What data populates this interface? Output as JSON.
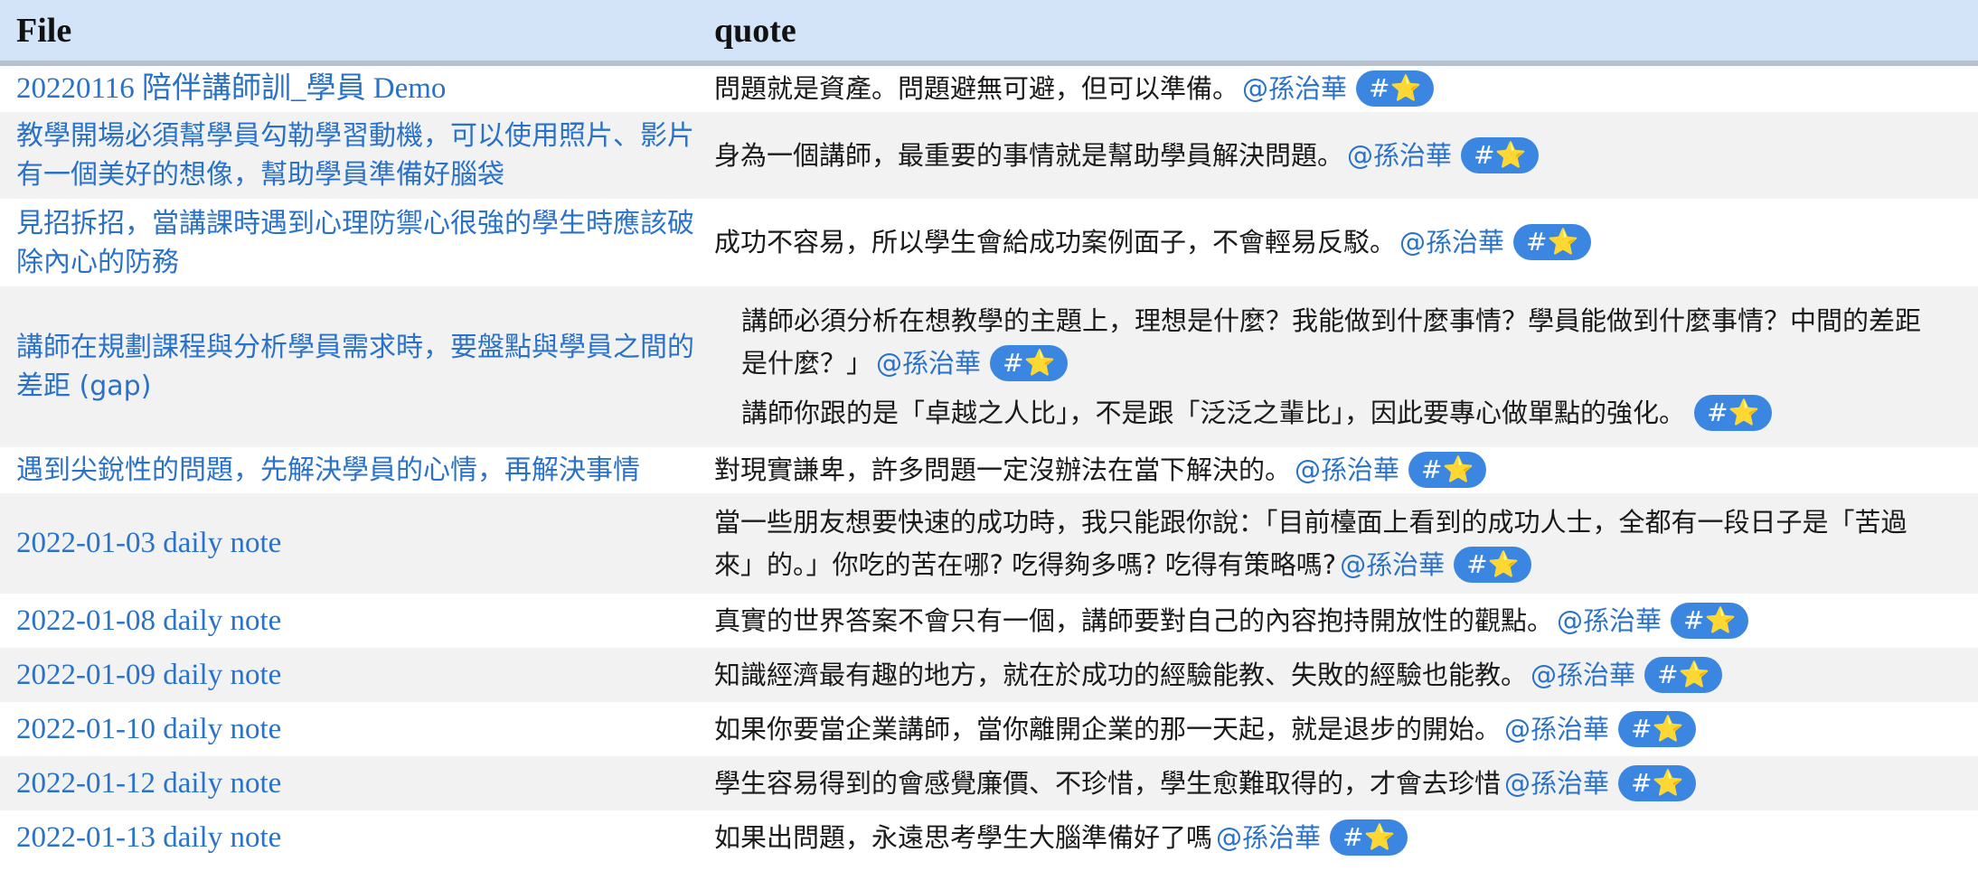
{
  "table": {
    "headers": {
      "file": "File",
      "quote": "quote"
    },
    "tag_label": "#",
    "tag_icon": "star-icon",
    "accent_color": "#2a72c8",
    "rows": [
      {
        "file": "20220116 陪伴講師訓_學員 Demo",
        "quotes": [
          {
            "text": "問題就是資產。問題避無可避，但可以準備。",
            "mention": "@孫治華",
            "tag": "#⭐"
          }
        ]
      },
      {
        "file": "教學開場必須幫學員勾勒學習動機，可以使用照片、影片有一個美好的想像，幫助學員準備好腦袋",
        "quotes": [
          {
            "text": "身為一個講師，最重要的事情就是幫助學員解決問題。",
            "mention": "@孫治華",
            "tag": "#⭐"
          }
        ]
      },
      {
        "file": "見招拆招，當講課時遇到心理防禦心很強的學生時應該破除內心的防務",
        "quotes": [
          {
            "text": "成功不容易，所以學生會給成功案例面子，不會輕易反駁。",
            "mention": "@孫治華",
            "tag": "#⭐"
          }
        ]
      },
      {
        "file": "講師在規劃課程與分析學員需求時，要盤點與學員之間的差距 (gap)",
        "quotes": [
          {
            "text": "講師必須分析在想教學的主題上，理想是什麼？我能做到什麼事情？學員能做到什麼事情？中間的差距是什麼？」",
            "mention": "@孫治華",
            "tag": "#⭐"
          },
          {
            "text": "講師你跟的是「卓越之人比」，不是跟「泛泛之輩比」，因此要專心做單點的強化。",
            "mention": "",
            "tag": "#⭐"
          }
        ]
      },
      {
        "file": "遇到尖銳性的問題，先解決學員的心情，再解決事情",
        "quotes": [
          {
            "text": "對現實謙卑，許多問題一定沒辦法在當下解決的。",
            "mention": "@孫治華",
            "tag": "#⭐"
          }
        ]
      },
      {
        "file": "2022-01-03 daily note",
        "quotes": [
          {
            "text": "當一些朋友想要快速的成功時，我只能跟你說：「目前檯面上看到的成功人士，全都有一段日子是「苦過來」的。」你吃的苦在哪? 吃得夠多嗎? 吃得有策略嗎?",
            "mention": "@孫治華",
            "tag": "#⭐"
          }
        ]
      },
      {
        "file": "2022-01-08 daily note",
        "quotes": [
          {
            "text": "真實的世界答案不會只有一個，講師要對自己的內容抱持開放性的觀點。",
            "mention": "@孫治華",
            "tag": "#⭐"
          }
        ]
      },
      {
        "file": "2022-01-09 daily note",
        "quotes": [
          {
            "text": "知識經濟最有趣的地方，就在於成功的經驗能教、失敗的經驗也能教。",
            "mention": "@孫治華",
            "tag": "#⭐"
          }
        ]
      },
      {
        "file": "2022-01-10 daily note",
        "quotes": [
          {
            "text": "如果你要當企業講師，當你離開企業的那一天起，就是退步的開始。",
            "mention": "@孫治華",
            "tag": "#⭐"
          }
        ]
      },
      {
        "file": "2022-01-12 daily note",
        "quotes": [
          {
            "text": "學生容易得到的會感覺廉價、不珍惜，學生愈難取得的，才會去珍惜",
            "mention": "@孫治華",
            "tag": "#⭐"
          }
        ]
      },
      {
        "file": "2022-01-13 daily note",
        "quotes": [
          {
            "text": "如果出問題，永遠思考學生大腦準備好了嗎",
            "mention": "@孫治華",
            "tag": "#⭐"
          }
        ]
      }
    ]
  }
}
